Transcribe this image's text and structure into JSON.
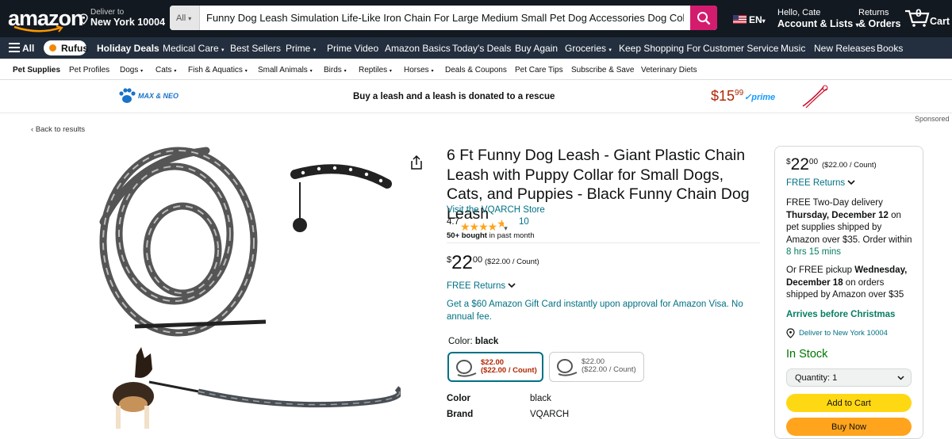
{
  "header": {
    "logo_text": "amazon",
    "deliver_to_line1": "Deliver to",
    "deliver_to_line2": "New York 10004",
    "search_category": "All",
    "search_value": "Funny Dog Leash Simulation Life-Like Iron Chain For Large Medium Small Pet Dog Accessories Dog Collar Dog leash",
    "language": "EN",
    "account_line1": "Hello, Cate",
    "account_line2": "Account & Lists",
    "returns_line1": "Returns",
    "returns_line2": "& Orders",
    "cart_count": "0",
    "cart_label": "Cart"
  },
  "subnav": {
    "all_label": "All",
    "rufus_label": "Rufus",
    "items": [
      "Holiday Deals",
      "Medical Care",
      "Best Sellers",
      "Prime",
      "Prime Video",
      "Amazon Basics",
      "Today's Deals",
      "Buy Again",
      "Groceries",
      "Keep Shopping For",
      "Customer Service",
      "Music",
      "New Releases",
      "Books"
    ]
  },
  "category_nav": {
    "items": [
      "Pet Supplies",
      "Pet Profiles",
      "Dogs",
      "Cats",
      "Fish & Aquatics",
      "Small Animals",
      "Birds",
      "Reptiles",
      "Horses",
      "Deals & Coupons",
      "Pet Care Tips",
      "Subscribe & Save",
      "Veterinary Diets"
    ]
  },
  "banner": {
    "brand": "MAX & NEO",
    "message": "Buy a leash and a leash is donated to a rescue",
    "price_whole": "$15",
    "price_cents": "99",
    "prime": "prime"
  },
  "sponsored": "Sponsored",
  "back_link": "Back to results",
  "product": {
    "title": "6 Ft Funny Dog Leash - Giant Plastic Chain Leash with Puppy Collar for Small Dogs, Cats, and Puppies - Black Funny Chain Dog Leash",
    "store_link": "Visit the VQARCH Store",
    "rating": "4.7",
    "rating_count": "10",
    "bought_bold": "50+ bought",
    "bought_rest": " in past month",
    "price_symbol": "$",
    "price_whole": "22",
    "price_cents": "00",
    "price_per": "($22.00 / Count)",
    "free_returns": "FREE Returns",
    "gift_card": "Get a $60 Amazon Gift Card instantly upon approval for Amazon Visa. No annual fee.",
    "color_label": "Color: ",
    "color_value": "black",
    "swatches": [
      {
        "price": "$22.00",
        "per": "($22.00 / Count)"
      },
      {
        "price": "$22.00",
        "per": "($22.00 / Count)"
      }
    ],
    "specs": [
      {
        "label": "Color",
        "value": "black"
      },
      {
        "label": "Brand",
        "value": "VQARCH"
      }
    ]
  },
  "buybox": {
    "price_symbol": "$",
    "price_whole": "22",
    "price_cents": "00",
    "price_per": "($22.00 / Count)",
    "free_returns": "FREE Returns",
    "delivery_a": "FREE Two-Day delivery ",
    "delivery_date": "Thursday, December 12",
    "delivery_b": " on pet supplies shipped by Amazon over $35. Order within ",
    "delivery_countdown": "8 hrs 15 mins",
    "pickup_a": "Or FREE pickup ",
    "pickup_date": "Wednesday, December 18",
    "pickup_b": " on orders shipped by Amazon over $35",
    "arrives": "Arrives before Christmas",
    "deliver_to": "Deliver to New York 10004",
    "stock": "In Stock",
    "quantity": "Quantity:  1",
    "add_to_cart": "Add to Cart",
    "buy_now": "Buy Now"
  },
  "colors": {
    "nav_dark": "#131921",
    "nav_sub": "#232f3e",
    "search_btn": "#d41c6e",
    "link": "#007185",
    "cart_btn": "#ffd814",
    "buy_btn": "#ffa41c"
  }
}
